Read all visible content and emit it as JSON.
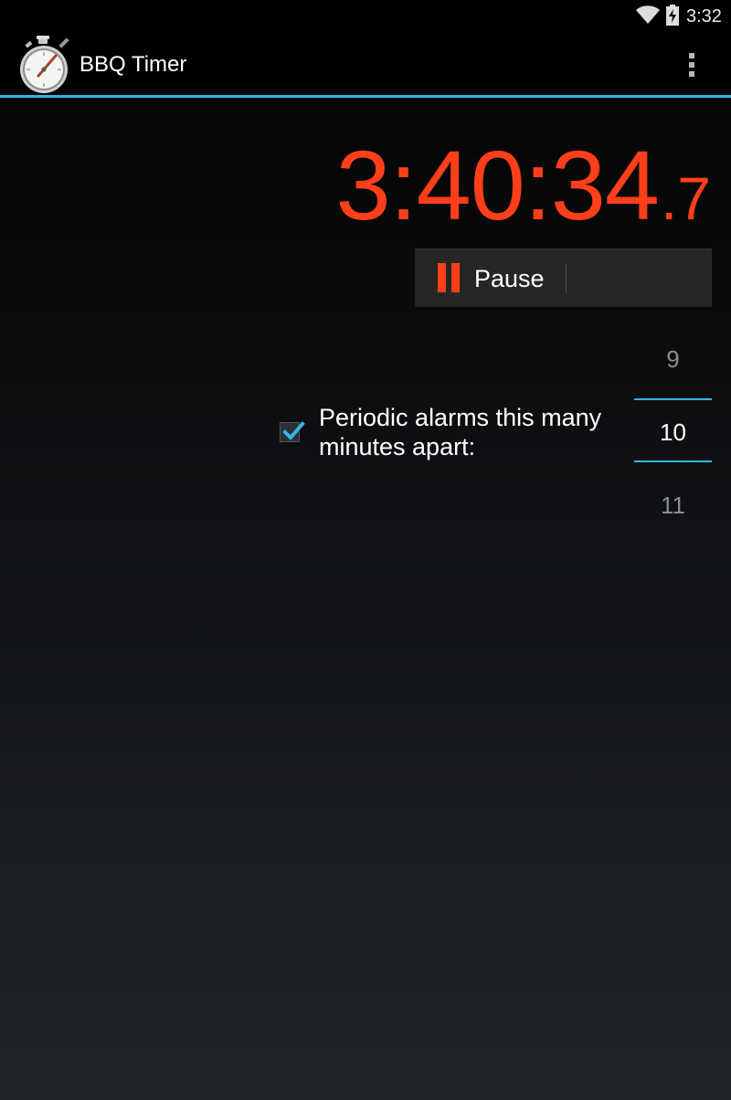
{
  "status_bar": {
    "time": "3:32",
    "icons": [
      "wifi-icon",
      "battery-charging-icon"
    ]
  },
  "action_bar": {
    "title": "BBQ Timer",
    "app_icon": "stopwatch-icon",
    "overflow_icon": "overflow-menu-icon"
  },
  "timer": {
    "main": "3:40:34",
    "tenths": ".7",
    "color": "#ff3f1a"
  },
  "pause_button": {
    "label": "Pause",
    "icon": "pause-icon"
  },
  "periodic_alarm": {
    "checked": true,
    "label": "Periodic alarms this many minutes apart:"
  },
  "number_picker": {
    "previous": "9",
    "current": "10",
    "next": "11"
  },
  "colors": {
    "accent": "#33b5e5",
    "timer": "#ff3f1a"
  }
}
